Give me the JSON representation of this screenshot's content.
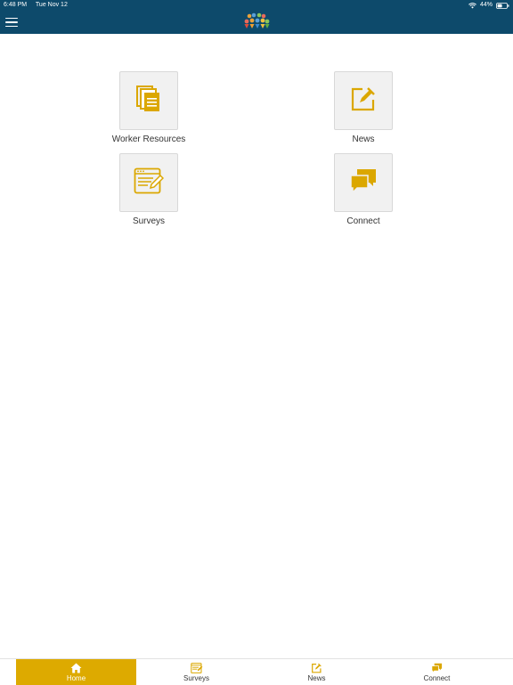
{
  "status_bar": {
    "time": "6:48 PM",
    "date": "Tue Nov 12",
    "battery": "44%"
  },
  "nav_bar": {
    "menu_icon": "hamburger-menu-icon",
    "logo_icon": "app-logo-icon"
  },
  "tiles": [
    {
      "label": "Worker Resources",
      "icon": "documents-icon"
    },
    {
      "label": "News",
      "icon": "edit-note-icon"
    },
    {
      "label": "Surveys",
      "icon": "survey-form-icon"
    },
    {
      "label": "Connect",
      "icon": "chat-bubbles-icon"
    }
  ],
  "tab_bar": {
    "active": "Home",
    "tabs": [
      {
        "label": "Home",
        "icon": "home-icon"
      },
      {
        "label": "Surveys",
        "icon": "survey-form-icon"
      },
      {
        "label": "News",
        "icon": "edit-note-icon"
      },
      {
        "label": "Connect",
        "icon": "chat-bubbles-icon"
      }
    ]
  },
  "colors": {
    "header": "#0d4a6b",
    "accent": "#ddaa00",
    "icon": "#dba700",
    "tile_bg": "#f1f1f1"
  }
}
